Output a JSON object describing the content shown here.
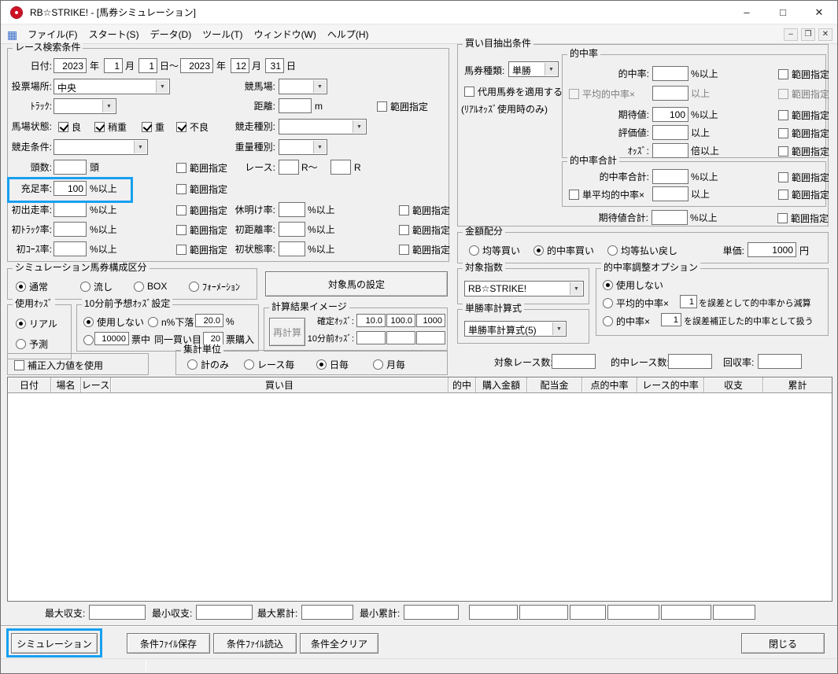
{
  "colors": {
    "annotation": "#16a0f0"
  },
  "glyphs": {
    "combo_arrow": "▼",
    "menu_icon": "▦"
  },
  "titlebar": {
    "title": "RB☆STRIKE! - [馬券シミュレーション]",
    "minimize": "–",
    "maximize": "□",
    "close": "✕"
  },
  "menubar": {
    "items": [
      "ファイル(F)",
      "スタート(S)",
      "データ(D)",
      "ツール(T)",
      "ウィンドウ(W)",
      "ヘルプ(H)"
    ],
    "mdi": {
      "minimize": "–",
      "restore": "❐",
      "close": "✕"
    }
  },
  "labels": {
    "range": "範囲指定",
    "pct_ge": "%以上",
    "ge": "以上",
    "times_ge": "倍以上"
  },
  "search": {
    "title": "レース検索条件",
    "date_label": "日付:",
    "from_year": "2023",
    "from_month": "1",
    "from_day": "1",
    "to_year": "2023",
    "to_month": "12",
    "to_day": "31",
    "year": "年",
    "month": "月",
    "day_tilde": "日～",
    "day": "日",
    "place_label": "投票場所:",
    "place_value": "中央",
    "course_label": "競馬場:",
    "track_label": "ﾄﾗｯｸ:",
    "distance_label": "距離:",
    "distance_unit": "m",
    "state_label": "馬場状態:",
    "state_opts": [
      "良",
      "稍重",
      "重",
      "不良"
    ],
    "race_kind_label": "競走種別:",
    "race_cond_label": "競走条件:",
    "weight_label": "重量種別:",
    "heads_label": "頭数:",
    "heads_unit": "頭",
    "raceno_label": "レース:",
    "raceno_mid": "R～",
    "raceno_unit": "R",
    "fill_label": "充足率:",
    "fill_value": "100",
    "first_run_label": "初出走率:",
    "rest_label": "休明け率:",
    "first_track_label": "初ﾄﾗｯｸ率:",
    "first_dist_label": "初距離率:",
    "first_course_label": "初ｺｰｽ率:",
    "first_state_label": "初状態率:"
  },
  "extract": {
    "title": "買い目抽出条件",
    "ticket_label": "馬券種類:",
    "ticket_value": "単勝",
    "substitute_label": "代用馬券を適用する",
    "substitute_note": "(ﾘｱﾙｵｯｽﾞ使用時のみ)",
    "hit": {
      "title": "的中率",
      "hit_label": "的中率:",
      "avg_label": "平均的中率×",
      "expect_label": "期待値:",
      "expect_value": "100",
      "eval_label": "評価値:",
      "odds_label": "ｵｯｽﾞ:"
    },
    "hit_total": {
      "title": "的中率合計",
      "total_label": "的中率合計:",
      "single_avg_label": "単平均的中率×"
    },
    "expect_total_label": "期待値合計:"
  },
  "amount": {
    "title": "金額配分",
    "opts": [
      "均等買い",
      "的中率買い",
      "均等払い戻し"
    ],
    "unit_label": "単価:",
    "unit_value": "1000",
    "unit_suffix": "円"
  },
  "composition": {
    "title": "シミュレーション馬券構成区分",
    "opts": [
      "通常",
      "流し",
      "BOX",
      "ﾌｫｰﾒｰｼｮﾝ"
    ]
  },
  "target_btn": "対象馬の設定",
  "odds_use": {
    "title": "使用ｵｯｽﾞ",
    "opts": [
      "リアル",
      "予測"
    ]
  },
  "pre_odds": {
    "title": "10分前予想ｵｯｽﾞ設定",
    "none": "使用しない",
    "drop": "n%下落",
    "drop_value": "20.0",
    "drop_unit": "%",
    "votes_value": "10000",
    "votes_label": "票中",
    "same_label": "同一買い目",
    "buy_value": "20",
    "buy_label": "票購入"
  },
  "calc": {
    "title": "計算結果イメージ",
    "recalc": "再計算",
    "fixed_label": "確定ｵｯｽﾞ:",
    "fixed_values": [
      "10.0",
      "100.0",
      "1000"
    ],
    "pre_label": "10分前ｵｯｽﾞ:"
  },
  "correction_label": "補正入力値を使用",
  "agg": {
    "title": "集計単位",
    "opts": [
      "計のみ",
      "レース毎",
      "日毎",
      "月毎"
    ]
  },
  "target_index": {
    "title": "対象指数",
    "value": "RB☆STRIKE!"
  },
  "win_formula": {
    "title": "単勝率計算式",
    "value": "単勝率計算式(5)"
  },
  "adjust": {
    "title": "的中率調整オプション",
    "opt_none": "使用しない",
    "opt2_pre": "平均的中率×",
    "opt2_value": "1",
    "opt2_post": "を誤差として的中率から減算",
    "opt3_pre": "的中率×",
    "opt3_value": "1",
    "opt3_post": "を誤差補正した的中率として扱う"
  },
  "counters": {
    "target_label": "対象レース数:",
    "hit_label": "的中レース数:",
    "recovery_label": "回収率:"
  },
  "table": {
    "headers": [
      "日付",
      "場名",
      "レース",
      "買い目",
      "的中",
      "購入金額",
      "配当金",
      "点的中率",
      "レース的中率",
      "収支",
      "累計"
    ]
  },
  "stats": {
    "max_balance": "最大収支:",
    "min_balance": "最小収支:",
    "max_total": "最大累計:",
    "min_total": "最小累計:"
  },
  "buttons": {
    "simulate": "シミュレーション",
    "save": "条件ﾌｧｲﾙ保存",
    "load": "条件ﾌｧｲﾙ読込",
    "clear": "条件全クリア",
    "close": "閉じる"
  }
}
